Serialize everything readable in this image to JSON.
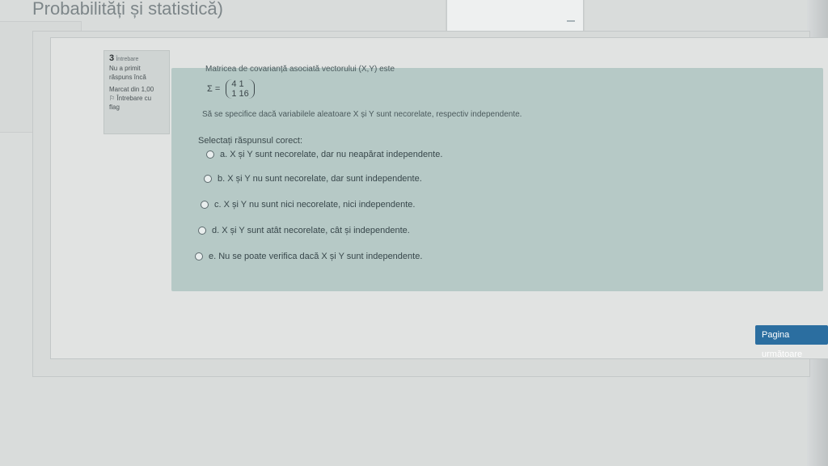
{
  "page": {
    "title": "Probabilități și statistică)"
  },
  "info": {
    "question_number": "3",
    "question_word": "Întrebare",
    "status_line1": "Nu a primit",
    "status_line2": "răspuns încă",
    "marked": "Marcat din 1,00",
    "flag_line1": "Întrebare cu",
    "flag_line2": "flag"
  },
  "question": {
    "line1": "Matricea de covarianță asociată vectorului (X,Y) este",
    "sigma": "Σ =",
    "matrix_row1": "4    1",
    "matrix_row2": "1    16",
    "line2": "Să se specifice dacă variabilele aleatoare X și Y sunt necorelate, respectiv independente.",
    "prompt": "Selectați răspunsul corect:"
  },
  "options": [
    {
      "label": "a. X și  Y sunt necorelate, dar nu neapărat independente."
    },
    {
      "label": "b. X și  Y nu sunt necorelate, dar sunt independente."
    },
    {
      "label": "c. X și  Y nu sunt nici necorelate, nici independente."
    },
    {
      "label": "d. X și  Y sunt atât necorelate, cât și independente."
    },
    {
      "label": "e. Nu se poate verifica dacă X  și  Y sunt independente."
    }
  ],
  "buttons": {
    "next": "Pagina următoare"
  }
}
